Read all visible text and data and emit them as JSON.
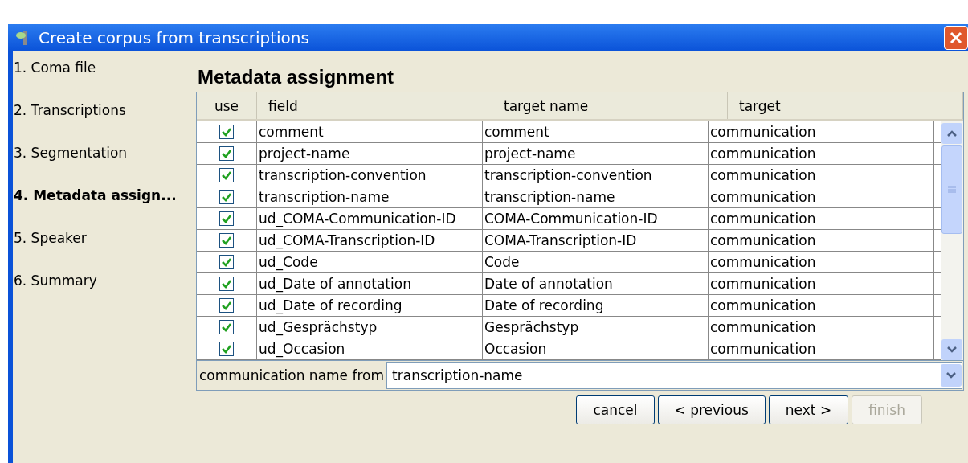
{
  "window": {
    "title": "Create corpus from transcriptions"
  },
  "steps": [
    {
      "label": "1. Coma file",
      "selected": false
    },
    {
      "label": "2. Transcriptions",
      "selected": false
    },
    {
      "label": "3. Segmentation",
      "selected": false
    },
    {
      "label": "4. Metadata assign...",
      "selected": true
    },
    {
      "label": "5. Speaker",
      "selected": false
    },
    {
      "label": "6. Summary",
      "selected": false
    }
  ],
  "heading": "Metadata assignment",
  "table": {
    "columns": [
      "use",
      "field",
      "target name",
      "target"
    ],
    "rows": [
      {
        "use": true,
        "field": "comment",
        "target_name": "comment",
        "target": "communication"
      },
      {
        "use": true,
        "field": "project-name",
        "target_name": "project-name",
        "target": "communication"
      },
      {
        "use": true,
        "field": "transcription-convention",
        "target_name": "transcription-convention",
        "target": "communication"
      },
      {
        "use": true,
        "field": "transcription-name",
        "target_name": "transcription-name",
        "target": "communication"
      },
      {
        "use": true,
        "field": "ud_COMA-Communication-ID",
        "target_name": "COMA-Communication-ID",
        "target": "communication"
      },
      {
        "use": true,
        "field": "ud_COMA-Transcription-ID",
        "target_name": "COMA-Transcription-ID",
        "target": "communication"
      },
      {
        "use": true,
        "field": "ud_Code",
        "target_name": "Code",
        "target": "communication"
      },
      {
        "use": true,
        "field": "ud_Date of annotation",
        "target_name": "Date of annotation",
        "target": "communication"
      },
      {
        "use": true,
        "field": "ud_Date of recording",
        "target_name": "Date of recording",
        "target": "communication"
      },
      {
        "use": true,
        "field": "ud_Gesprächstyp",
        "target_name": "Gesprächstyp",
        "target": "communication"
      },
      {
        "use": true,
        "field": "ud_Occasion",
        "target_name": "Occasion",
        "target": "communication"
      }
    ]
  },
  "name_from": {
    "label": "communication name from",
    "value": "transcription-name"
  },
  "buttons": [
    {
      "label": "cancel",
      "disabled": false
    },
    {
      "label": "< previous",
      "disabled": false
    },
    {
      "label": "next >",
      "disabled": false
    },
    {
      "label": "finish",
      "disabled": true
    }
  ]
}
